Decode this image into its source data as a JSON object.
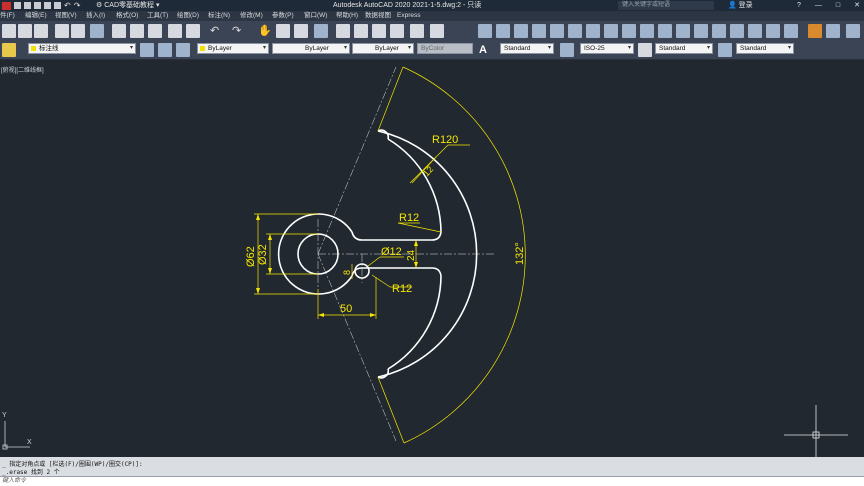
{
  "titlebar": {
    "workspace": "CAD零基础教程",
    "title": "Autodesk AutoCAD 2020    2021-1-5.dwg:2 - 只读",
    "search_placeholder": "键入关键字或短语",
    "login": "登录",
    "min": "—",
    "max": "□",
    "close": "✕"
  },
  "menu": [
    "件(F)",
    "编辑(E)",
    "视图(V)",
    "插入(I)",
    "格式(O)",
    "工具(T)",
    "绘图(D)",
    "标注(N)",
    "修改(M)",
    "参数(P)",
    "窗口(W)",
    "帮助(H)",
    "数据视图",
    "Express"
  ],
  "toolbar": {
    "layer": "标注线",
    "color": "ByLayer",
    "linetype": "ByLayer",
    "lineweight": "ByLayer",
    "plotstyle": "ByColor",
    "text_style": "Standard",
    "dim_style": "ISO-25",
    "table_style": "Standard",
    "mleader_style": "Standard"
  },
  "viewport_label": "[俯视][二维线框]",
  "dimensions": {
    "r120": "R120",
    "r12_arc": "12",
    "r12_left": "R12",
    "r12_bottom": "R12",
    "d62": "Ø62",
    "d32": "Ø32",
    "d12": "Ø12",
    "v24": "24",
    "v8": "8",
    "h50": "50",
    "angle132": "132°"
  },
  "ucs": {
    "y": "Y",
    "x": "X"
  },
  "command": {
    "line1": "_ 指定对角点或 [栏选(F)/圈围(WP)/圈交(CP)]:",
    "line2": "_.erase 找到 2 个",
    "prompt": "键入命令"
  },
  "colors": {
    "background": "#212830",
    "geometry": "#ffffff",
    "dimension": "#f5e600"
  }
}
